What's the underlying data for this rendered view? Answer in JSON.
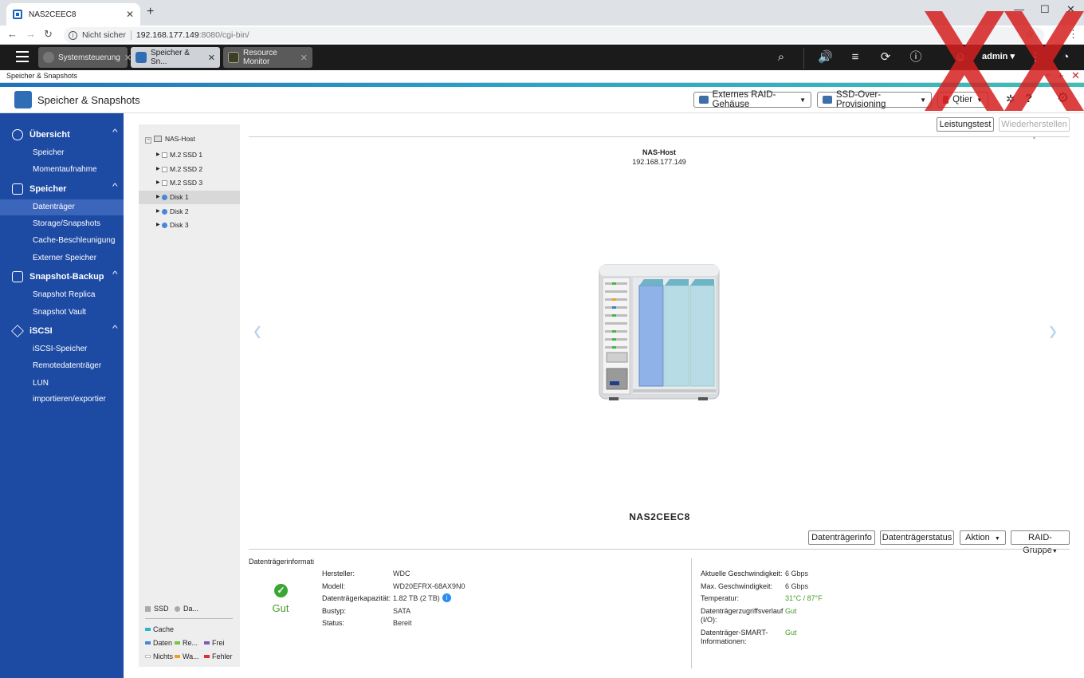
{
  "browser": {
    "tab_title": "NAS2CEEC8",
    "address": {
      "not_secure": "Nicht sicher",
      "host": "192.168.177.149",
      "path": ":8080/cgi-bin/"
    }
  },
  "topbar": {
    "tabs": [
      {
        "label": "Systemsteuerung"
      },
      {
        "label": "Speicher & Sn..."
      },
      {
        "label": "Resource Monitor"
      }
    ],
    "user": "admin ▾"
  },
  "window_title": "Speicher & Snapshots",
  "app": {
    "name": "Speicher & Snapshots",
    "buttons": {
      "raid": "Externes RAID-Gehäuse",
      "ssd": "SSD-Over-Provisioning",
      "qtier": "Qtier"
    }
  },
  "sidebar": {
    "groups": [
      {
        "label": "Übersicht",
        "items": [
          "Speicher",
          "Momentaufnahme"
        ]
      },
      {
        "label": "Speicher",
        "items": [
          "Datenträger",
          "Storage/Snapshots",
          "Cache-Beschleunigung",
          "Externer Speicher"
        ]
      },
      {
        "label": "Snapshot-Backup",
        "items": [
          "Snapshot Replica",
          "Snapshot Vault"
        ]
      },
      {
        "label": "iSCSI",
        "items": [
          "iSCSI-Speicher",
          "Remotedatenträger",
          "LUN importieren/exportier"
        ]
      }
    ],
    "active_item": "Datenträger"
  },
  "tree": {
    "root": "NAS-Host",
    "nodes": [
      "M.2 SSD 1",
      "M.2 SSD 2",
      "M.2 SSD 3",
      "Disk 1",
      "Disk 2",
      "Disk 3"
    ],
    "selected": "Disk 1"
  },
  "legend": {
    "ssd": "SSD",
    "da": "Da...",
    "cache": "Cache",
    "daten": "Daten",
    "re": "Re...",
    "frei": "Frei",
    "nichts": "Nichts",
    "wa": "Wa...",
    "fehler": "Fehler",
    "colors": {
      "cache": "#2bb5c9",
      "daten": "#4a86d8",
      "re": "#7cc242",
      "frei": "#7d5ab5",
      "nichts": "#ffffff",
      "wa": "#f0a020",
      "fehler": "#d93030"
    }
  },
  "main": {
    "btn_test": "Leistungstest",
    "btn_restore": "Wiederherstellen",
    "host_name": "NAS-Host",
    "host_ip": "192.168.177.149",
    "device_name": "NAS2CEEC8",
    "btn_info": "Datenträgerinfo",
    "btn_status": "Datenträgerstatus",
    "btn_action": "Aktion",
    "btn_raid": "RAID-Gruppe"
  },
  "disk_info": {
    "title": "Datenträgerinformati",
    "health": "Gut",
    "left": [
      {
        "k": "Hersteller:",
        "v": "WDC"
      },
      {
        "k": "Modell:",
        "v": "WD20EFRX-68AX9N0"
      },
      {
        "k": "Datenträgerkapazität:",
        "v": "1.82 TB (2 TB)"
      },
      {
        "k": "Bustyp:",
        "v": "SATA"
      },
      {
        "k": "Status:",
        "v": "Bereit"
      }
    ],
    "right": [
      {
        "k": "Aktuelle Geschwindigkeit:",
        "v": "6 Gbps"
      },
      {
        "k": "Max. Geschwindigkeit:",
        "v": "6 Gbps"
      },
      {
        "k": "Temperatur:",
        "v": "31°C / 87°F"
      },
      {
        "k1": "Datenträgerzugriffsverlauf",
        "k2": "(I/O):",
        "v": "Gut"
      },
      {
        "k1": "Datenträger-SMART-",
        "k2": "Informationen:",
        "v": "Gut"
      }
    ],
    "colors": {
      "good": "#4a9a2a"
    }
  }
}
